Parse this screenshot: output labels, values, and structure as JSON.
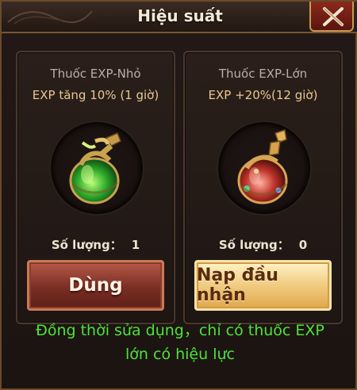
{
  "dialog": {
    "title": "Hiệu suất"
  },
  "items": [
    {
      "name": "Thuốc EXP-Nhỏ",
      "effect": "EXP tăng 10% (1 giờ)",
      "quantity_label": "Số lượng：",
      "quantity": "1",
      "button_label": "Dùng"
    },
    {
      "name": "Thuốc EXP-Lớn",
      "effect": "EXP +20%(12 giờ)",
      "quantity_label": "Số lượng：",
      "quantity": "0",
      "button_label": "Nạp đầu nhận"
    }
  ],
  "notice": {
    "line1": "Đồng thời sửa dụng，chỉ có thuốc EXP",
    "line2": "lớn có hiệu lực"
  },
  "colors": {
    "notice_green": "#4ee23a",
    "effect_gold": "#e8c88e",
    "use_button": "#7a2e24",
    "topup_button": "#f2cf86"
  },
  "icons": {
    "close": "close-x-icon",
    "small_potion": "green-potion-icon",
    "large_potion": "red-potion-icon"
  }
}
